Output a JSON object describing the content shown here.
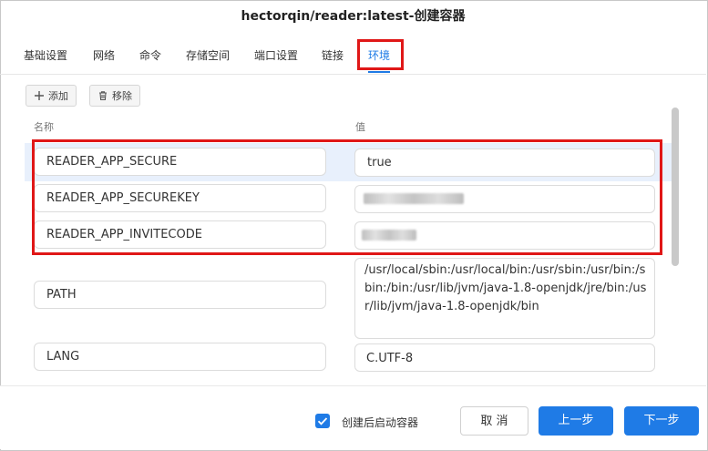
{
  "dialog": {
    "title": "hectorqin/reader:latest-创建容器"
  },
  "tabs": [
    {
      "label": "基础设置"
    },
    {
      "label": "网络"
    },
    {
      "label": "命令"
    },
    {
      "label": "存储空间"
    },
    {
      "label": "端口设置"
    },
    {
      "label": "链接"
    },
    {
      "label": "环境",
      "active": true
    }
  ],
  "toolbar": {
    "add_label": "添加",
    "remove_label": "移除"
  },
  "columns": {
    "name": "名称",
    "value": "值"
  },
  "env": [
    {
      "name": "READER_APP_SECURE",
      "value": "true"
    },
    {
      "name": "READER_APP_SECUREKEY",
      "value": "",
      "value_hidden": true
    },
    {
      "name": "READER_APP_INVITECODE",
      "value": "",
      "value_hidden": true
    },
    {
      "name": "PATH",
      "value": "/usr/local/sbin:/usr/local/bin:/usr/sbin:/usr/bin:/sbin:/bin:/usr/lib/jvm/java-1.8-openjdk/jre/bin:/usr/lib/jvm/java-1.8-openjdk/bin"
    },
    {
      "name": "LANG",
      "value": "C.UTF-8"
    }
  ],
  "footer": {
    "start_after_create_label": "创建后启动容器",
    "start_after_create_checked": true,
    "cancel_label": "取 消",
    "prev_label": "上一步",
    "next_label": "下一步"
  },
  "colors": {
    "accent": "#1f7be6",
    "highlight": "#e01717",
    "selected_row": "#e8f0fc"
  },
  "icons": {
    "add": "plus-icon",
    "remove": "trash-icon",
    "checkbox": "checkmark-icon"
  }
}
